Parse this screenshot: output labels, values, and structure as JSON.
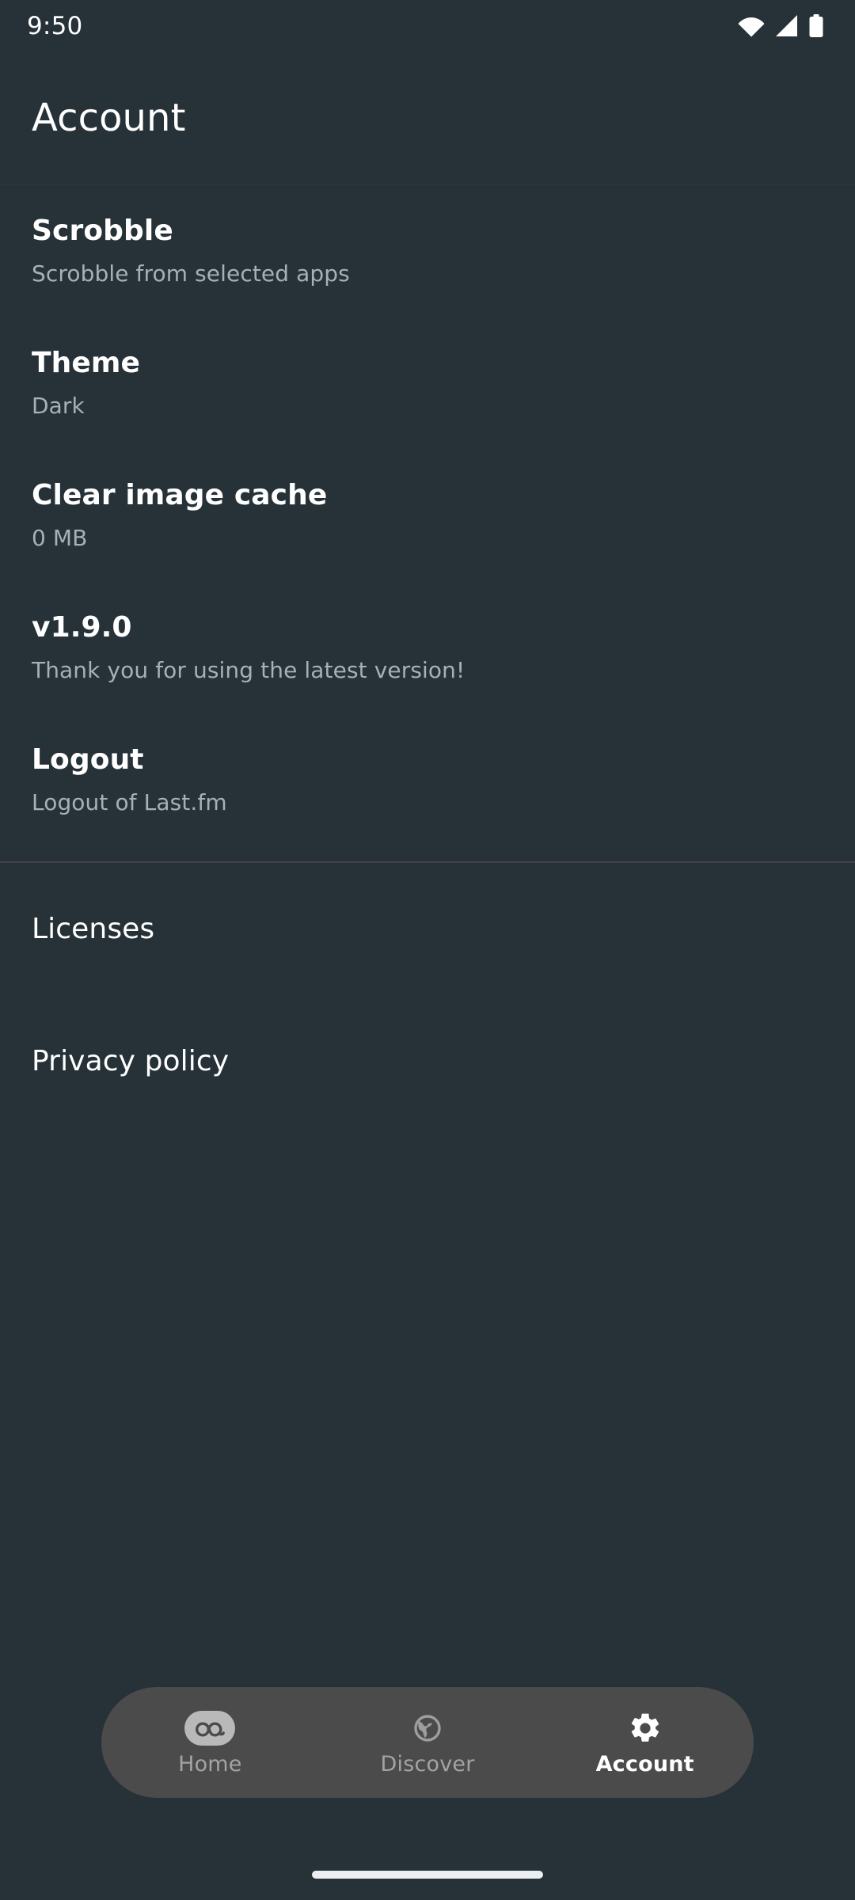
{
  "status_bar": {
    "clock": "9:50",
    "icons": [
      "wifi-icon",
      "cellular-signal-icon",
      "battery-icon"
    ]
  },
  "app_bar": {
    "title": "Account"
  },
  "settings": [
    {
      "title": "Scrobble",
      "subtitle": "Scrobble from selected apps"
    },
    {
      "title": "Theme",
      "subtitle": "Dark"
    },
    {
      "title": "Clear image cache",
      "subtitle": "0 MB"
    },
    {
      "title": "v1.9.0",
      "subtitle": "Thank you for using the latest version!"
    },
    {
      "title": "Logout",
      "subtitle": "Logout of Last.fm"
    }
  ],
  "links": [
    {
      "label": "Licenses"
    },
    {
      "label": "Privacy policy"
    }
  ],
  "bottom_nav": {
    "items": [
      {
        "label": "Home",
        "icon": "lastfm-as-logo-icon",
        "active": false
      },
      {
        "label": "Discover",
        "icon": "globe-icon",
        "active": false
      },
      {
        "label": "Account",
        "icon": "gear-icon",
        "active": true
      }
    ]
  },
  "colors": {
    "background": "#263238",
    "primary_text": "#ffffff",
    "secondary_text": "#a6b0b6",
    "nav_pill_background": "#4b4b4b",
    "nav_inactive_text": "#a3a3a3",
    "nav_icon_circle": "#b9b9b9",
    "section_divider": "#4a4458",
    "gesture_bar": "#eceff1"
  }
}
